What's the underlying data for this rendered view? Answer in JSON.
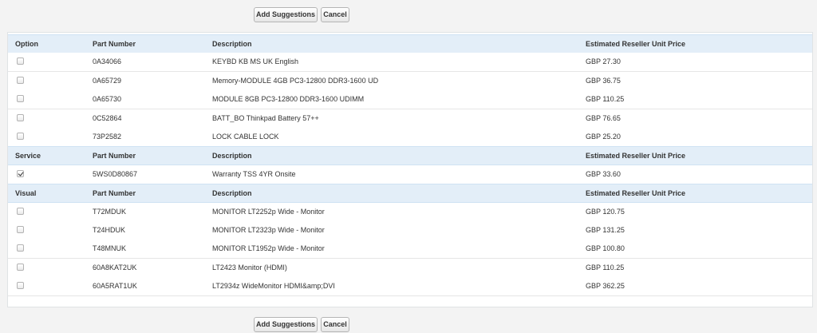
{
  "toolbar": {
    "add_label": "Add Suggestions",
    "cancel_label": "Cancel"
  },
  "sections": [
    {
      "headers": [
        "Option",
        "Part Number",
        "Description",
        "Estimated Reseller Unit Price"
      ],
      "rows": [
        {
          "checked": false,
          "part": "0A34066",
          "desc": "KEYBD KB MS UK English",
          "price": "GBP 27.30"
        },
        {
          "checked": false,
          "part": "0A65729",
          "desc": "Memory-MODULE 4GB PC3-12800 DDR3-1600 UD",
          "price": "GBP 36.75"
        },
        {
          "checked": false,
          "part": "0A65730",
          "desc": "MODULE 8GB PC3-12800 DDR3-1600 UDIMM",
          "price": "GBP 110.25"
        },
        {
          "checked": false,
          "part": "0C52864",
          "desc": "BATT_BO Thinkpad Battery 57++",
          "price": "GBP 76.65"
        },
        {
          "checked": false,
          "part": "73P2582",
          "desc": "LOCK CABLE LOCK",
          "price": "GBP 25.20"
        }
      ]
    },
    {
      "headers": [
        "Service",
        "Part Number",
        "Description",
        "Estimated Reseller Unit Price"
      ],
      "rows": [
        {
          "checked": true,
          "part": "5WS0D80867",
          "desc": "Warranty TSS 4YR Onsite",
          "price": "GBP 33.60"
        }
      ]
    },
    {
      "headers": [
        "Visual",
        "Part Number",
        "Description",
        "Estimated Reseller Unit Price"
      ],
      "rows": [
        {
          "checked": false,
          "part": "T72MDUK",
          "desc": "MONITOR LT2252p Wide - Monitor",
          "price": "GBP 120.75"
        },
        {
          "checked": false,
          "part": "T24HDUK",
          "desc": "MONITOR LT2323p Wide - Monitor",
          "price": "GBP 131.25"
        },
        {
          "checked": false,
          "part": "T48MNUK",
          "desc": "MONITOR LT1952p Wide - Monitor",
          "price": "GBP 100.80"
        },
        {
          "checked": false,
          "part": "60A8KAT2UK",
          "desc": "LT2423 Monitor (HDMI)",
          "price": "GBP 110.25"
        },
        {
          "checked": false,
          "part": "60A5RAT1UK",
          "desc": "LT2934z WideMonitor HDMI&amp;DVI",
          "price": "GBP 362.25"
        }
      ]
    }
  ]
}
